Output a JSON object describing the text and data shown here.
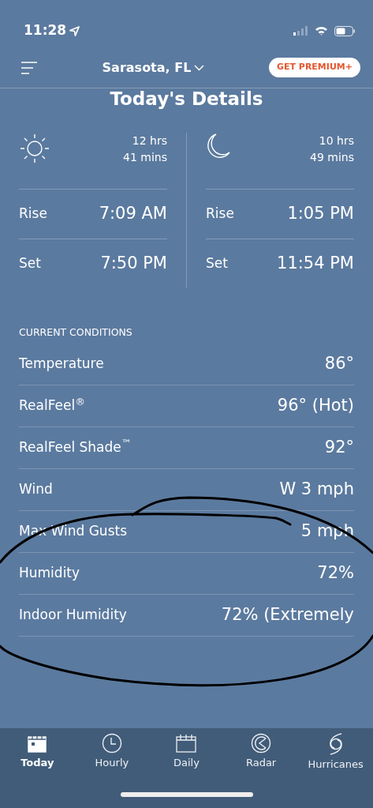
{
  "status_bar": {
    "time": "11:28"
  },
  "header": {
    "location": "Sarasota, FL",
    "premium_button": "GET PREMIUM+"
  },
  "title": "Today's Details",
  "sun_moon": [
    {
      "kind": "sun",
      "duration_hours": "12 hrs",
      "duration_mins": "41 mins",
      "rows": [
        {
          "label": "Rise",
          "value": "7:09 AM"
        },
        {
          "label": "Set",
          "value": "7:50 PM"
        }
      ]
    },
    {
      "kind": "moon",
      "duration_hours": "10 hrs",
      "duration_mins": "49 mins",
      "rows": [
        {
          "label": "Rise",
          "value": "1:05 PM"
        },
        {
          "label": "Set",
          "value": "11:54 PM"
        }
      ]
    }
  ],
  "current_conditions": {
    "heading": "CURRENT CONDITIONS",
    "rows": [
      {
        "label": "Temperature",
        "value": "86°"
      },
      {
        "label": "RealFeel$^{®}$",
        "value": "96° (Hot)"
      },
      {
        "label": "RealFeel Shade$^{™}$",
        "value": "92°"
      },
      {
        "label": "Wind",
        "value": "W 3 mph"
      },
      {
        "label": "Max Wind Gusts",
        "value": "5 mph"
      },
      {
        "label": "Humidity",
        "value": "72%"
      },
      {
        "label": "Indoor Humidity",
        "value": "72% (Extremely"
      }
    ]
  },
  "tab_bar": [
    {
      "label": "Today",
      "kind": "today",
      "selected": true
    },
    {
      "label": "Hourly",
      "kind": "hourly",
      "selected": false
    },
    {
      "label": "Daily",
      "kind": "daily",
      "selected": false
    },
    {
      "label": "Radar",
      "kind": "radar",
      "selected": false
    },
    {
      "label": "Hurricanes",
      "kind": "hurricanes",
      "selected": false
    }
  ]
}
